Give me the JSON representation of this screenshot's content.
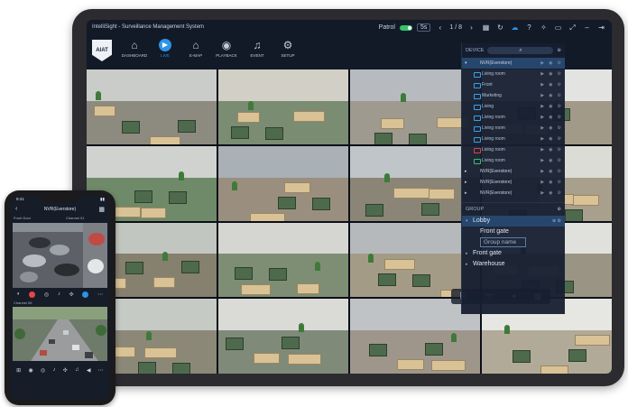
{
  "app": {
    "title": "IntelliSight - Surveillance Management System",
    "patrol_label": "Patrol",
    "interval": "5s",
    "page_indicator": "1 / 8",
    "colors": {
      "accent": "#2d93e8",
      "toggle_on": "#35c26a",
      "record": "#e8454a"
    }
  },
  "nav": {
    "logo_text": "AIAT",
    "items": [
      {
        "label": "DASHBOARD",
        "icon": "home-icon"
      },
      {
        "label": "LIVE",
        "icon": "play-icon",
        "active": true
      },
      {
        "label": "E-MAP",
        "icon": "map-icon"
      },
      {
        "label": "PLAYBACK",
        "icon": "playback-icon"
      },
      {
        "label": "EVENT",
        "icon": "bell-icon"
      },
      {
        "label": "SETUP",
        "icon": "gear-icon"
      }
    ]
  },
  "tile_toolbar": {
    "icons": [
      "split-icon",
      "camera-icon",
      "record-icon",
      "calendar-icon"
    ]
  },
  "panel": {
    "device_label": "DEVICE",
    "group_label": "GROUP",
    "nvrs": [
      {
        "name": "NVR(Everstore)",
        "selected": true,
        "expanded": true,
        "cameras": [
          {
            "name": "Living room",
            "status": "blue"
          },
          {
            "name": "Front",
            "status": "blue"
          },
          {
            "name": "Marketing",
            "status": "blue"
          },
          {
            "name": "Living",
            "status": "blue"
          },
          {
            "name": "Living room",
            "status": "blue"
          },
          {
            "name": "Living room",
            "status": "blue"
          },
          {
            "name": "Living room",
            "status": "blue"
          },
          {
            "name": "Living room",
            "status": "red"
          },
          {
            "name": "Living room",
            "status": "green"
          }
        ]
      },
      {
        "name": "NVR(Everstore)",
        "status": "blue"
      },
      {
        "name": "NVR(Everstore)",
        "status": "green"
      },
      {
        "name": "NVR(Everstore)",
        "status": "red"
      }
    ],
    "groups": [
      {
        "name": "Lobby",
        "level": 0,
        "selected": true
      },
      {
        "name": "Front gate",
        "level": 1
      },
      {
        "name": "Group name",
        "level": 1,
        "editing": true
      },
      {
        "name": "Front gate",
        "level": 0
      },
      {
        "name": "Warehouse",
        "level": 0
      }
    ]
  },
  "phone": {
    "time": "9:41",
    "title": "NVR(Everstore)",
    "camera_1_label": "Front Door",
    "camera_1_channel": "Channel 01",
    "camera_2_label": "Channel 06"
  }
}
